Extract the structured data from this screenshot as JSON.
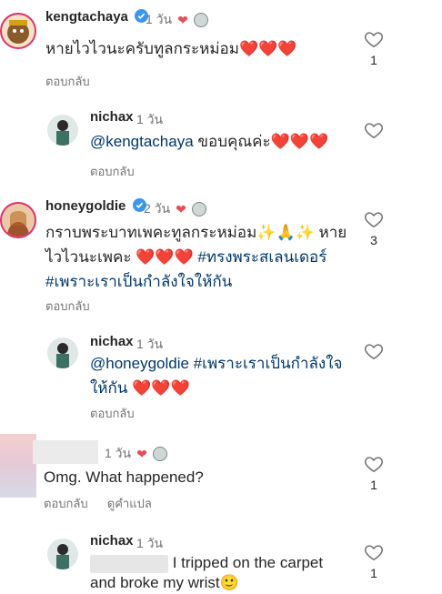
{
  "comments": [
    {
      "username": "kengtachaya",
      "time": "1 วัน",
      "text": "หายไวไวนะครับทูลกระหม่อม",
      "hearts": "❤️❤️❤️",
      "reply_label": "ตอบกลับ",
      "like_count": "1"
    },
    {
      "username": "nichax",
      "time": "1 วัน",
      "mention": "@kengtachaya",
      "text": " ขอบคุณค่ะ",
      "hearts": "❤️❤️❤️",
      "reply_label": "ตอบกลับ"
    },
    {
      "username": "honeygoldie",
      "time": "2 วัน",
      "text_line1": "กราบพระบาทเพคะทูลกระหม่อม✨🙏✨ หาย",
      "text_line2a": "ไวไวนะเพคะ ",
      "hearts": "❤️❤️❤️",
      "hashtag1": " #ทรงพระสเลนเดอร์",
      "hashtag2": "#เพราะเราเป็นกำลังใจให้กัน",
      "reply_label": "ตอบกลับ",
      "like_count": "3"
    },
    {
      "username": "nichax",
      "time": "1 วัน",
      "mention": "@honeygoldie",
      "hashtag_line1": " #เพราะเราเป็นกำลังใจ",
      "hashtag_line2": "ให้กัน",
      "hearts": " ❤️❤️❤️",
      "reply_label": "ตอบกลับ"
    },
    {
      "time": "1 วัน",
      "text": "Omg. What happened?",
      "reply_label": "ตอบกลับ",
      "translate_label": "ดูคำแปล",
      "like_count": "1"
    },
    {
      "username": "nichax",
      "time": "1 วัน",
      "text_line1": " I tripped on the carpet",
      "text_line2": "and broke my wrist",
      "emoji": "🙂",
      "like_count": "1"
    }
  ]
}
